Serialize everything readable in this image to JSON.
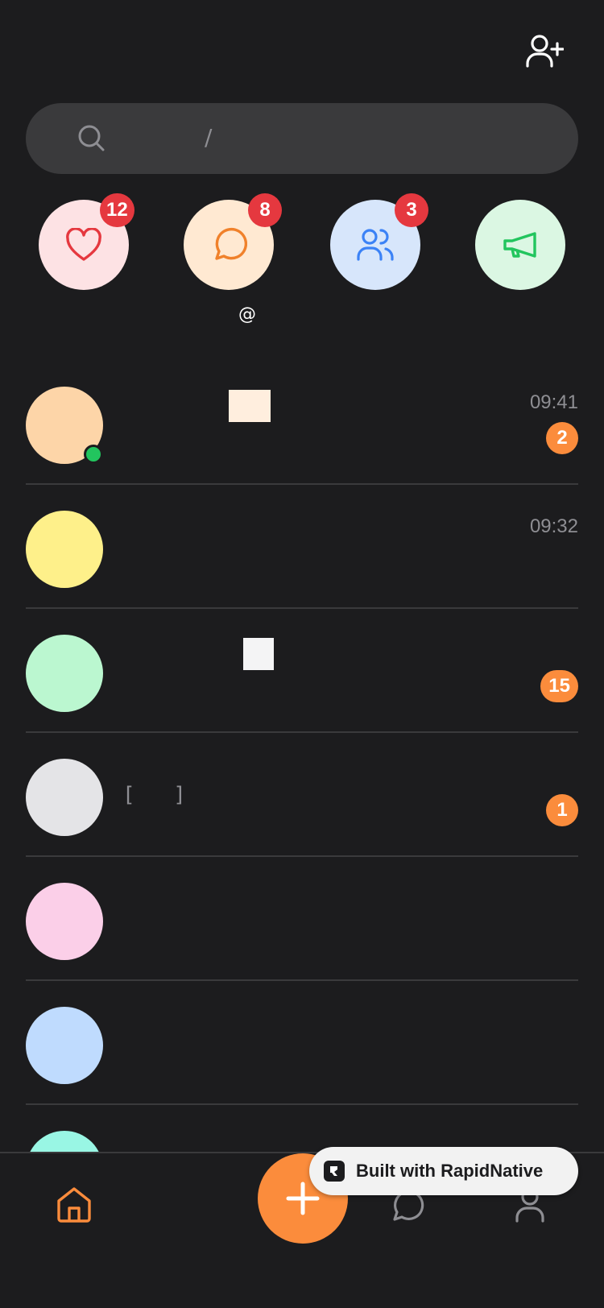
{
  "header": {
    "add_friend_icon": "user-plus-icon"
  },
  "search": {
    "icon": "search-icon",
    "shortcut": "/"
  },
  "quick_actions": [
    {
      "name": "likes",
      "icon": "heart-icon",
      "badge": "12",
      "bg": "#fde2e4",
      "color": "#e5383f"
    },
    {
      "name": "comments",
      "icon": "chat-bubble-icon",
      "badge": "8",
      "bg": "#ffe9d2",
      "color": "#f0812b"
    },
    {
      "name": "followers",
      "icon": "users-icon",
      "badge": "3",
      "bg": "#d7e6fb",
      "color": "#3b82f6"
    },
    {
      "name": "announcements",
      "icon": "megaphone-icon",
      "badge": "",
      "bg": "#dbf7e3",
      "color": "#22c55e"
    }
  ],
  "mention_label": "@",
  "conversations": [
    {
      "avatar_color": "#fdd5a8",
      "time": "09:41",
      "unread": "2",
      "online": true,
      "thumb_color": "#ffeede"
    },
    {
      "avatar_color": "#fef08a",
      "time": "09:32",
      "unread": "",
      "online": false
    },
    {
      "avatar_color": "#bbf7d0",
      "time": "",
      "unread": "15",
      "online": false,
      "thumb_color": "#f4f4f5"
    },
    {
      "avatar_color": "#e4e4e7",
      "time": "",
      "unread": "1",
      "online": false,
      "preview": "[ ]"
    },
    {
      "avatar_color": "#fbcfe8",
      "time": "",
      "unread": "",
      "online": false
    },
    {
      "avatar_color": "#bfdbfe",
      "time": "",
      "unread": "",
      "online": false
    },
    {
      "avatar_color": "#99f6e4",
      "time": "",
      "unread": "",
      "online": false
    }
  ],
  "bottom_nav": [
    {
      "icon": "home-icon",
      "active": true
    },
    {
      "icon": "plus-icon"
    },
    {
      "icon": "chat-bubble-icon"
    },
    {
      "icon": "profile-icon"
    }
  ],
  "built_with": {
    "label": "Built with RapidNative"
  },
  "colors": {
    "accent": "#fb8c3c",
    "badge_red": "#e5383f",
    "bg": "#1c1c1e"
  }
}
